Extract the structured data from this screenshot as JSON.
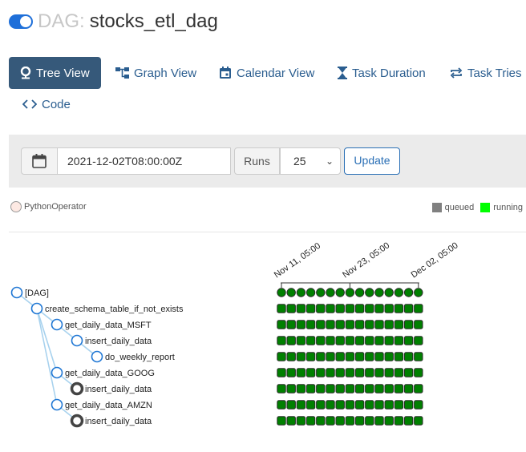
{
  "header": {
    "dag_label": "DAG:",
    "dag_id": "stocks_etl_dag"
  },
  "tabs": [
    {
      "label": "Tree View",
      "icon": "tree-icon",
      "active": true
    },
    {
      "label": "Graph View",
      "icon": "graph-icon"
    },
    {
      "label": "Calendar View",
      "icon": "calendar-icon"
    },
    {
      "label": "Task Duration",
      "icon": "hourglass-icon"
    },
    {
      "label": "Task Tries",
      "icon": "retry-icon"
    },
    {
      "label": "Code",
      "icon": "code-icon"
    }
  ],
  "controls": {
    "base_date": "2021-12-02T08:00:00Z",
    "runs_label": "Runs",
    "runs_value": "25",
    "update_label": "Update"
  },
  "legend": {
    "operator": "PythonOperator",
    "states": [
      {
        "label": "queued",
        "color": "#808080"
      },
      {
        "label": "running",
        "color": "#00ff00"
      }
    ]
  },
  "dates": [
    "Nov 11, 05:00",
    "Nov 23, 05:00",
    "Dec 02, 05:00"
  ],
  "run_count": 15,
  "status_color": "#008000",
  "tree": [
    {
      "label": "[DAG]",
      "depth": 0,
      "kind": "dag"
    },
    {
      "label": "create_schema_table_if_not_exists",
      "depth": 1,
      "kind": "task"
    },
    {
      "label": "get_daily_data_MSFT",
      "depth": 2,
      "kind": "task"
    },
    {
      "label": "insert_daily_data",
      "depth": 3,
      "kind": "task"
    },
    {
      "label": "do_weekly_report",
      "depth": 4,
      "kind": "task"
    },
    {
      "label": "get_daily_data_GOOG",
      "depth": 2,
      "kind": "task"
    },
    {
      "label": "insert_daily_data",
      "depth": 3,
      "kind": "repeat"
    },
    {
      "label": "get_daily_data_AMZN",
      "depth": 2,
      "kind": "task"
    },
    {
      "label": "insert_daily_data",
      "depth": 3,
      "kind": "repeat"
    }
  ]
}
